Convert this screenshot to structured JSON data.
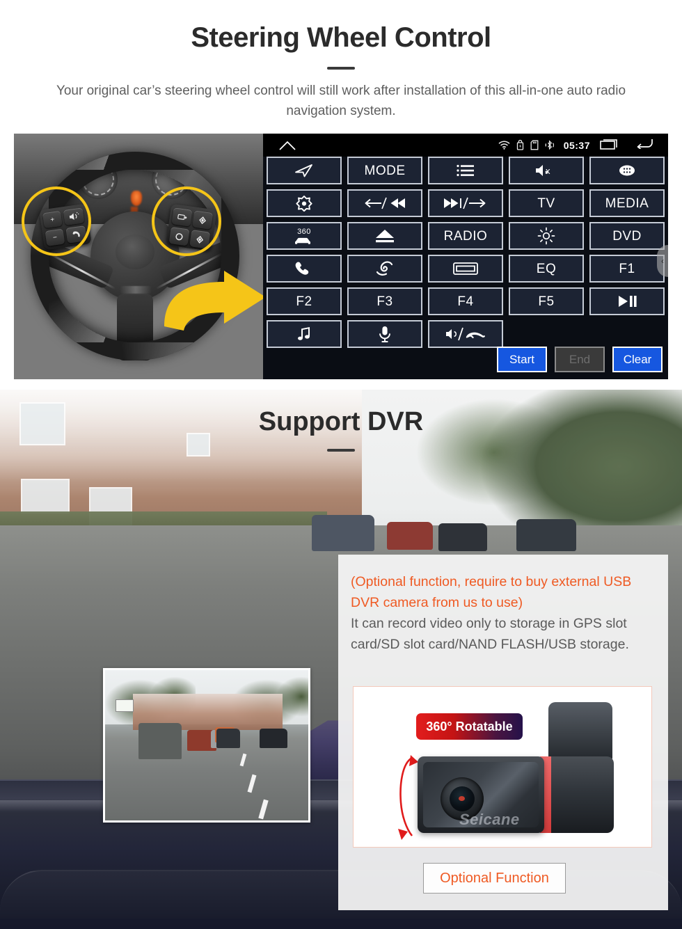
{
  "steering_section": {
    "title": "Steering Wheel Control",
    "subtitle": "Your original car’s steering wheel control will still work after installation of this all-in-one auto radio navigation system.",
    "head_unit": {
      "status_bar": {
        "time": "05:37",
        "icons": [
          "home-icon",
          "wifi-icon",
          "battery-lock-icon",
          "sd-card-icon",
          "bluetooth-icon",
          "recent-apps-icon",
          "back-icon"
        ]
      },
      "buttons": [
        {
          "label": "",
          "icon": "navigation-arrow-icon"
        },
        {
          "label": "MODE",
          "icon": ""
        },
        {
          "label": "",
          "icon": "list-icon"
        },
        {
          "label": "",
          "icon": "mute-icon"
        },
        {
          "label": "",
          "icon": "apps-icon"
        },
        {
          "label": "",
          "icon": "power-eye-icon"
        },
        {
          "label": "",
          "icon": "prev-track-icon"
        },
        {
          "label": "",
          "icon": "next-track-icon"
        },
        {
          "label": "TV",
          "icon": ""
        },
        {
          "label": "MEDIA",
          "icon": ""
        },
        {
          "label": "",
          "icon": "360-car-icon"
        },
        {
          "label": "",
          "icon": "eject-icon"
        },
        {
          "label": "RADIO",
          "icon": ""
        },
        {
          "label": "",
          "icon": "brightness-icon"
        },
        {
          "label": "DVD",
          "icon": ""
        },
        {
          "label": "",
          "icon": "phone-answer-icon"
        },
        {
          "label": "",
          "icon": "swirl-icon"
        },
        {
          "label": "",
          "icon": "screen-icon"
        },
        {
          "label": "EQ",
          "icon": ""
        },
        {
          "label": "F1",
          "icon": ""
        },
        {
          "label": "F2",
          "icon": ""
        },
        {
          "label": "F3",
          "icon": ""
        },
        {
          "label": "F4",
          "icon": ""
        },
        {
          "label": "F5",
          "icon": ""
        },
        {
          "label": "",
          "icon": "play-pause-icon"
        },
        {
          "label": "",
          "icon": "music-note-icon"
        },
        {
          "label": "",
          "icon": "microphone-icon"
        },
        {
          "label": "",
          "icon": "volume-hangup-icon"
        }
      ],
      "actions": {
        "start": "Start",
        "end": "End",
        "clear": "Clear"
      }
    },
    "wheel_keys": {
      "volume_up": "+",
      "volume_down": "−",
      "voice": "voice-icon",
      "answer": "phone-icon",
      "source": "source-icon",
      "mode": "mode-icon",
      "up": "up-icon",
      "down": "down-icon"
    }
  },
  "dvr_section": {
    "title": "Support DVR",
    "panel": {
      "highlight": "(Optional function, require to buy external USB DVR camera from us to use)",
      "body": "It can record video only to storage in GPS slot card/SD slot card/NAND FLASH/USB storage.",
      "badge": "360° Rotatable",
      "brand": "Seicane",
      "button": "Optional Function"
    }
  },
  "colors": {
    "accent_orange": "#ef5a23",
    "highlight_yellow": "#f5c518",
    "button_blue": "#1657e0",
    "panel_bg": "#f6f6f6",
    "heading": "#2b2b2b"
  }
}
